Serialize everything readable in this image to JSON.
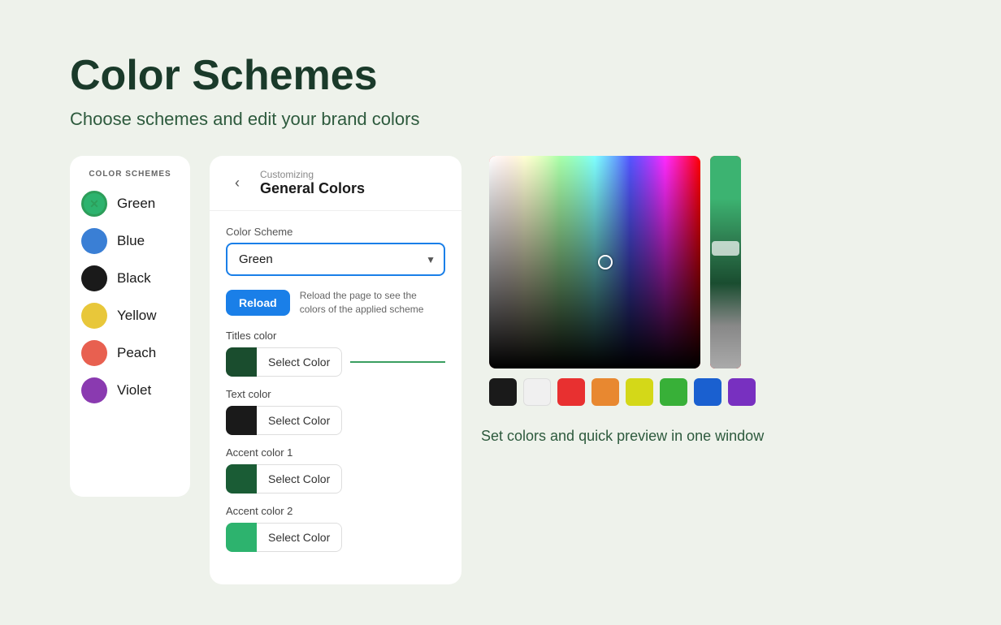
{
  "page": {
    "title": "Color Schemes",
    "subtitle": "Choose schemes and edit your brand colors"
  },
  "sidebar": {
    "label": "COLOR\nSCHEMES",
    "items": [
      {
        "id": "green",
        "name": "Green",
        "color": "#2db36e",
        "selected": true
      },
      {
        "id": "blue",
        "name": "Blue",
        "color": "#3a7fd5"
      },
      {
        "id": "black",
        "name": "Black",
        "color": "#1a1a1a"
      },
      {
        "id": "yellow",
        "name": "Yellow",
        "color": "#e8c73a"
      },
      {
        "id": "peach",
        "name": "Peach",
        "color": "#e86050"
      },
      {
        "id": "violet",
        "name": "Violet",
        "color": "#8a3ab0"
      }
    ]
  },
  "panel": {
    "back_label": "‹",
    "header_sub": "Customizing",
    "header_title": "General Colors",
    "color_scheme_label": "Color Scheme",
    "color_scheme_value": "Green",
    "color_scheme_options": [
      "Green",
      "Blue",
      "Black",
      "Yellow",
      "Peach",
      "Violet"
    ],
    "reload_btn_label": "Reload",
    "reload_hint": "Reload the page to see the colors of the applied scheme",
    "color_fields": [
      {
        "id": "titles",
        "label": "Titles color",
        "swatch": "#1a4d2e",
        "btn_label": "Select Color"
      },
      {
        "id": "text",
        "label": "Text color",
        "swatch": "#1a1a1a",
        "btn_label": "Select Color"
      },
      {
        "id": "accent1",
        "label": "Accent color 1",
        "swatch": "#1a5c35",
        "btn_label": "Select Color"
      },
      {
        "id": "accent2",
        "label": "Accent color 2",
        "swatch": "#2db36e",
        "btn_label": "Select Color"
      }
    ]
  },
  "picker": {
    "preset_colors": [
      {
        "id": "black",
        "color": "#1a1a1a"
      },
      {
        "id": "white",
        "color": "#f0f0f0"
      },
      {
        "id": "red",
        "color": "#e83030"
      },
      {
        "id": "orange",
        "color": "#e88830"
      },
      {
        "id": "yellow",
        "color": "#d4d818"
      },
      {
        "id": "green",
        "color": "#38b038"
      },
      {
        "id": "blue",
        "color": "#1a60d0"
      },
      {
        "id": "purple",
        "color": "#7830c0"
      }
    ],
    "description": "Set colors and quick\npreview in one window"
  }
}
